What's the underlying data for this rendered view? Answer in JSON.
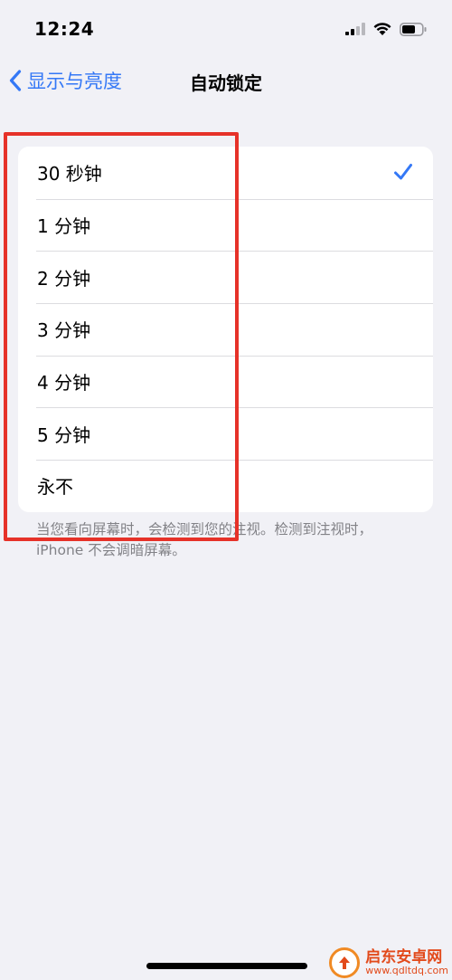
{
  "status_bar": {
    "time": "12:24",
    "icons": [
      "cellular-signal-icon",
      "wifi-icon",
      "battery-icon"
    ]
  },
  "nav": {
    "back_label": "显示与亮度",
    "title": "自动锁定"
  },
  "options": [
    {
      "label": "30 秒钟",
      "selected": true
    },
    {
      "label": "1 分钟",
      "selected": false
    },
    {
      "label": "2 分钟",
      "selected": false
    },
    {
      "label": "3 分钟",
      "selected": false
    },
    {
      "label": "4 分钟",
      "selected": false
    },
    {
      "label": "5 分钟",
      "selected": false
    },
    {
      "label": "永不",
      "selected": false
    }
  ],
  "footnote": "当您看向屏幕时，会检测到您的注视。检测到注视时，iPhone 不会调暗屏幕。",
  "watermark": {
    "title": "启东安卓网",
    "url": "www.qdltdq.com"
  },
  "colors": {
    "accent": "#3478f6",
    "highlight": "#e63229",
    "background": "#f1f1f6"
  }
}
